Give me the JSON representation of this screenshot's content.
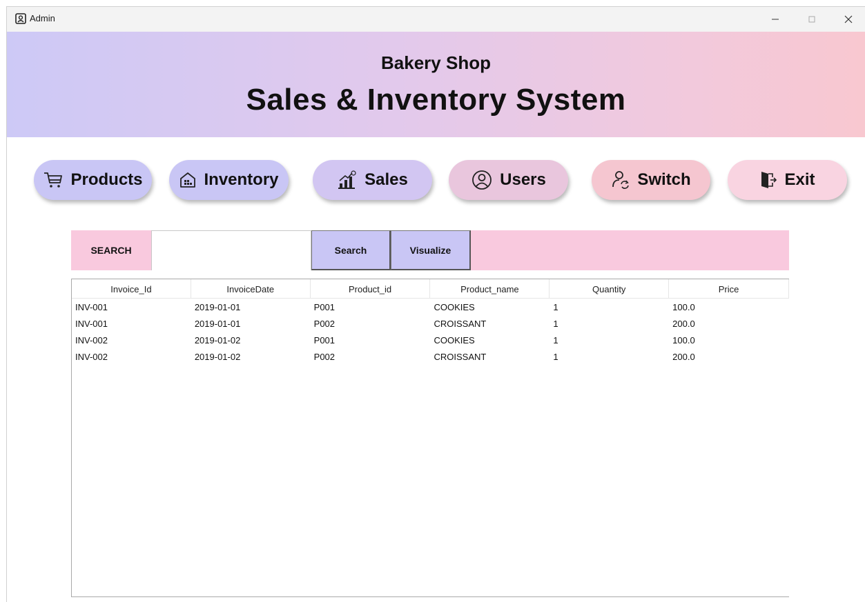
{
  "window": {
    "title": "Admin"
  },
  "header": {
    "subtitle": "Bakery Shop",
    "title": "Sales & Inventory System"
  },
  "nav": [
    {
      "label": "Products",
      "icon": "cart-icon"
    },
    {
      "label": "Inventory",
      "icon": "warehouse-icon"
    },
    {
      "label": "Sales",
      "icon": "sales-chart-icon"
    },
    {
      "label": "Users",
      "icon": "user-circle-icon"
    },
    {
      "label": "Switch",
      "icon": "switch-user-icon"
    },
    {
      "label": "Exit",
      "icon": "exit-door-icon"
    }
  ],
  "search": {
    "label": "SEARCH",
    "value": "",
    "search_button": "Search",
    "visualize_button": "Visualize"
  },
  "table": {
    "columns": [
      "Invoice_Id",
      "InvoiceDate",
      "Product_id",
      "Product_name",
      "Quantity",
      "Price"
    ],
    "rows": [
      [
        "INV-001",
        "2019-01-01",
        "P001",
        "COOKIES",
        "1",
        "100.0"
      ],
      [
        "INV-001",
        "2019-01-01",
        "P002",
        "CROISSANT",
        "1",
        "200.0"
      ],
      [
        "INV-002",
        "2019-01-02",
        "P001",
        "COOKIES",
        "1",
        "100.0"
      ],
      [
        "INV-002",
        "2019-01-02",
        "P002",
        "CROISSANT",
        "1",
        "200.0"
      ]
    ]
  },
  "colors": {
    "lavender": "#c9c6f5",
    "pink": "#f9c9de",
    "banner_left": "#cdc9f6",
    "banner_right": "#f8c8d0"
  }
}
